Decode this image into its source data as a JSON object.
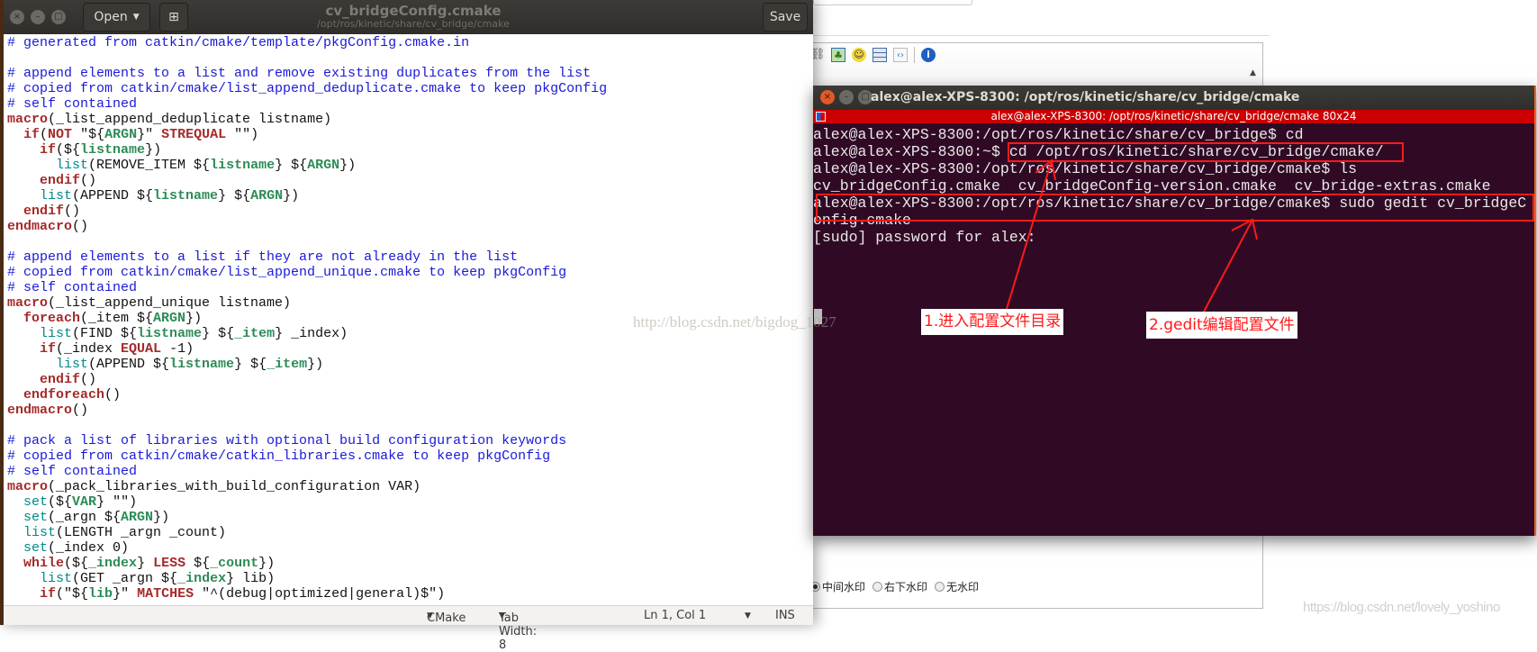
{
  "background_editor": {
    "toolbar_icons": [
      "link-icon",
      "image-icon",
      "smiley-icon",
      "table-icon",
      "code-icon",
      "info-icon"
    ],
    "watermark_options": [
      {
        "label": "中间水印",
        "selected": true
      },
      {
        "label": "右下水印",
        "selected": false
      },
      {
        "label": "无水印",
        "selected": false
      }
    ],
    "watermark_text": "https://blog.csdn.net/lovely_yoshino"
  },
  "overlay_watermark": "http://blog.csdn.net/bigdog_1027",
  "gedit": {
    "open_label": "Open",
    "title": "cv_bridgeConfig.cmake",
    "subtitle": "/opt/ros/kinetic/share/cv_bridge/cmake",
    "save_label": "Save",
    "status": {
      "language": "CMake",
      "tab_width": "Tab Width: 8",
      "position": "Ln 1, Col 1",
      "mode": "INS"
    },
    "code_lines": [
      [
        [
          "c",
          "# generated from catkin/cmake/template/pkgConfig.cmake.in"
        ]
      ],
      [],
      [
        [
          "c",
          "# append elements to a list and remove existing duplicates from the list"
        ]
      ],
      [
        [
          "c",
          "# copied from catkin/cmake/list_append_deduplicate.cmake to keep pkgConfig"
        ]
      ],
      [
        [
          "c",
          "# self contained"
        ]
      ],
      [
        [
          "k",
          "macro"
        ],
        [
          "n",
          "(_list_append_deduplicate listname)"
        ]
      ],
      [
        [
          "n",
          "  "
        ],
        [
          "k",
          "if"
        ],
        [
          "n",
          "("
        ],
        [
          "o",
          "NOT"
        ],
        [
          "n",
          " \"${"
        ],
        [
          "v",
          "ARGN"
        ],
        [
          "n",
          "}\" "
        ],
        [
          "o",
          "STREQUAL"
        ],
        [
          "n",
          " \"\")"
        ]
      ],
      [
        [
          "n",
          "    "
        ],
        [
          "k",
          "if"
        ],
        [
          "n",
          "(${"
        ],
        [
          "v",
          "listname"
        ],
        [
          "n",
          "})"
        ]
      ],
      [
        [
          "n",
          "      "
        ],
        [
          "f",
          "list"
        ],
        [
          "n",
          "(REMOVE_ITEM ${"
        ],
        [
          "v",
          "listname"
        ],
        [
          "n",
          "} ${"
        ],
        [
          "v",
          "ARGN"
        ],
        [
          "n",
          "})"
        ]
      ],
      [
        [
          "n",
          "    "
        ],
        [
          "k",
          "endif"
        ],
        [
          "n",
          "()"
        ]
      ],
      [
        [
          "n",
          "    "
        ],
        [
          "f",
          "list"
        ],
        [
          "n",
          "(APPEND ${"
        ],
        [
          "v",
          "listname"
        ],
        [
          "n",
          "} ${"
        ],
        [
          "v",
          "ARGN"
        ],
        [
          "n",
          "})"
        ]
      ],
      [
        [
          "n",
          "  "
        ],
        [
          "k",
          "endif"
        ],
        [
          "n",
          "()"
        ]
      ],
      [
        [
          "k",
          "endmacro"
        ],
        [
          "n",
          "()"
        ]
      ],
      [],
      [
        [
          "c",
          "# append elements to a list if they are not already in the list"
        ]
      ],
      [
        [
          "c",
          "# copied from catkin/cmake/list_append_unique.cmake to keep pkgConfig"
        ]
      ],
      [
        [
          "c",
          "# self contained"
        ]
      ],
      [
        [
          "k",
          "macro"
        ],
        [
          "n",
          "(_list_append_unique listname)"
        ]
      ],
      [
        [
          "n",
          "  "
        ],
        [
          "k",
          "foreach"
        ],
        [
          "n",
          "(_item ${"
        ],
        [
          "v",
          "ARGN"
        ],
        [
          "n",
          "})"
        ]
      ],
      [
        [
          "n",
          "    "
        ],
        [
          "f",
          "list"
        ],
        [
          "n",
          "(FIND ${"
        ],
        [
          "v",
          "listname"
        ],
        [
          "n",
          "} ${"
        ],
        [
          "v",
          "_item"
        ],
        [
          "n",
          "} _index)"
        ]
      ],
      [
        [
          "n",
          "    "
        ],
        [
          "k",
          "if"
        ],
        [
          "n",
          "(_index "
        ],
        [
          "o",
          "EQUAL"
        ],
        [
          "n",
          " -1)"
        ]
      ],
      [
        [
          "n",
          "      "
        ],
        [
          "f",
          "list"
        ],
        [
          "n",
          "(APPEND ${"
        ],
        [
          "v",
          "listname"
        ],
        [
          "n",
          "} ${"
        ],
        [
          "v",
          "_item"
        ],
        [
          "n",
          "})"
        ]
      ],
      [
        [
          "n",
          "    "
        ],
        [
          "k",
          "endif"
        ],
        [
          "n",
          "()"
        ]
      ],
      [
        [
          "n",
          "  "
        ],
        [
          "k",
          "endforeach"
        ],
        [
          "n",
          "()"
        ]
      ],
      [
        [
          "k",
          "endmacro"
        ],
        [
          "n",
          "()"
        ]
      ],
      [],
      [
        [
          "c",
          "# pack a list of libraries with optional build configuration keywords"
        ]
      ],
      [
        [
          "c",
          "# copied from catkin/cmake/catkin_libraries.cmake to keep pkgConfig"
        ]
      ],
      [
        [
          "c",
          "# self contained"
        ]
      ],
      [
        [
          "k",
          "macro"
        ],
        [
          "n",
          "(_pack_libraries_with_build_configuration VAR)"
        ]
      ],
      [
        [
          "n",
          "  "
        ],
        [
          "f",
          "set"
        ],
        [
          "n",
          "(${"
        ],
        [
          "v",
          "VAR"
        ],
        [
          "n",
          "} \"\")"
        ]
      ],
      [
        [
          "n",
          "  "
        ],
        [
          "f",
          "set"
        ],
        [
          "n",
          "(_argn ${"
        ],
        [
          "v",
          "ARGN"
        ],
        [
          "n",
          "})"
        ]
      ],
      [
        [
          "n",
          "  "
        ],
        [
          "f",
          "list"
        ],
        [
          "n",
          "(LENGTH _argn _count)"
        ]
      ],
      [
        [
          "n",
          "  "
        ],
        [
          "f",
          "set"
        ],
        [
          "n",
          "(_index 0)"
        ]
      ],
      [
        [
          "n",
          "  "
        ],
        [
          "k",
          "while"
        ],
        [
          "n",
          "(${"
        ],
        [
          "v",
          "_index"
        ],
        [
          "n",
          "} "
        ],
        [
          "o",
          "LESS"
        ],
        [
          "n",
          " ${"
        ],
        [
          "v",
          "_count"
        ],
        [
          "n",
          "})"
        ]
      ],
      [
        [
          "n",
          "    "
        ],
        [
          "f",
          "list"
        ],
        [
          "n",
          "(GET _argn ${"
        ],
        [
          "v",
          "_index"
        ],
        [
          "n",
          "} lib)"
        ]
      ],
      [
        [
          "n",
          "    "
        ],
        [
          "k",
          "if"
        ],
        [
          "n",
          "(\"${"
        ],
        [
          "v",
          "lib"
        ],
        [
          "n",
          "}\" "
        ],
        [
          "o",
          "MATCHES"
        ],
        [
          "n",
          " \"^(debug|optimized|general)$\")"
        ]
      ]
    ]
  },
  "terminal": {
    "title": "alex@alex-XPS-8300: /opt/ros/kinetic/share/cv_bridge/cmake",
    "tab_title": "alex@alex-XPS-8300: /opt/ros/kinetic/share/cv_bridge/cmake 80x24",
    "lines": [
      "alex@alex-XPS-8300:/opt/ros/kinetic/share/cv_bridge$ cd",
      "alex@alex-XPS-8300:~$ cd /opt/ros/kinetic/share/cv_bridge/cmake/",
      "alex@alex-XPS-8300:/opt/ros/kinetic/share/cv_bridge/cmake$ ls",
      "cv_bridgeConfig.cmake  cv_bridgeConfig-version.cmake  cv_bridge-extras.cmake",
      "alex@alex-XPS-8300:/opt/ros/kinetic/share/cv_bridge/cmake$ sudo gedit cv_bridgeC",
      "onfig.cmake",
      "[sudo] password for alex:"
    ]
  },
  "annotations": {
    "color": "#ff1a1a",
    "step1": "1.进入配置文件目录",
    "step2": "2.gedit编辑配置文件"
  }
}
